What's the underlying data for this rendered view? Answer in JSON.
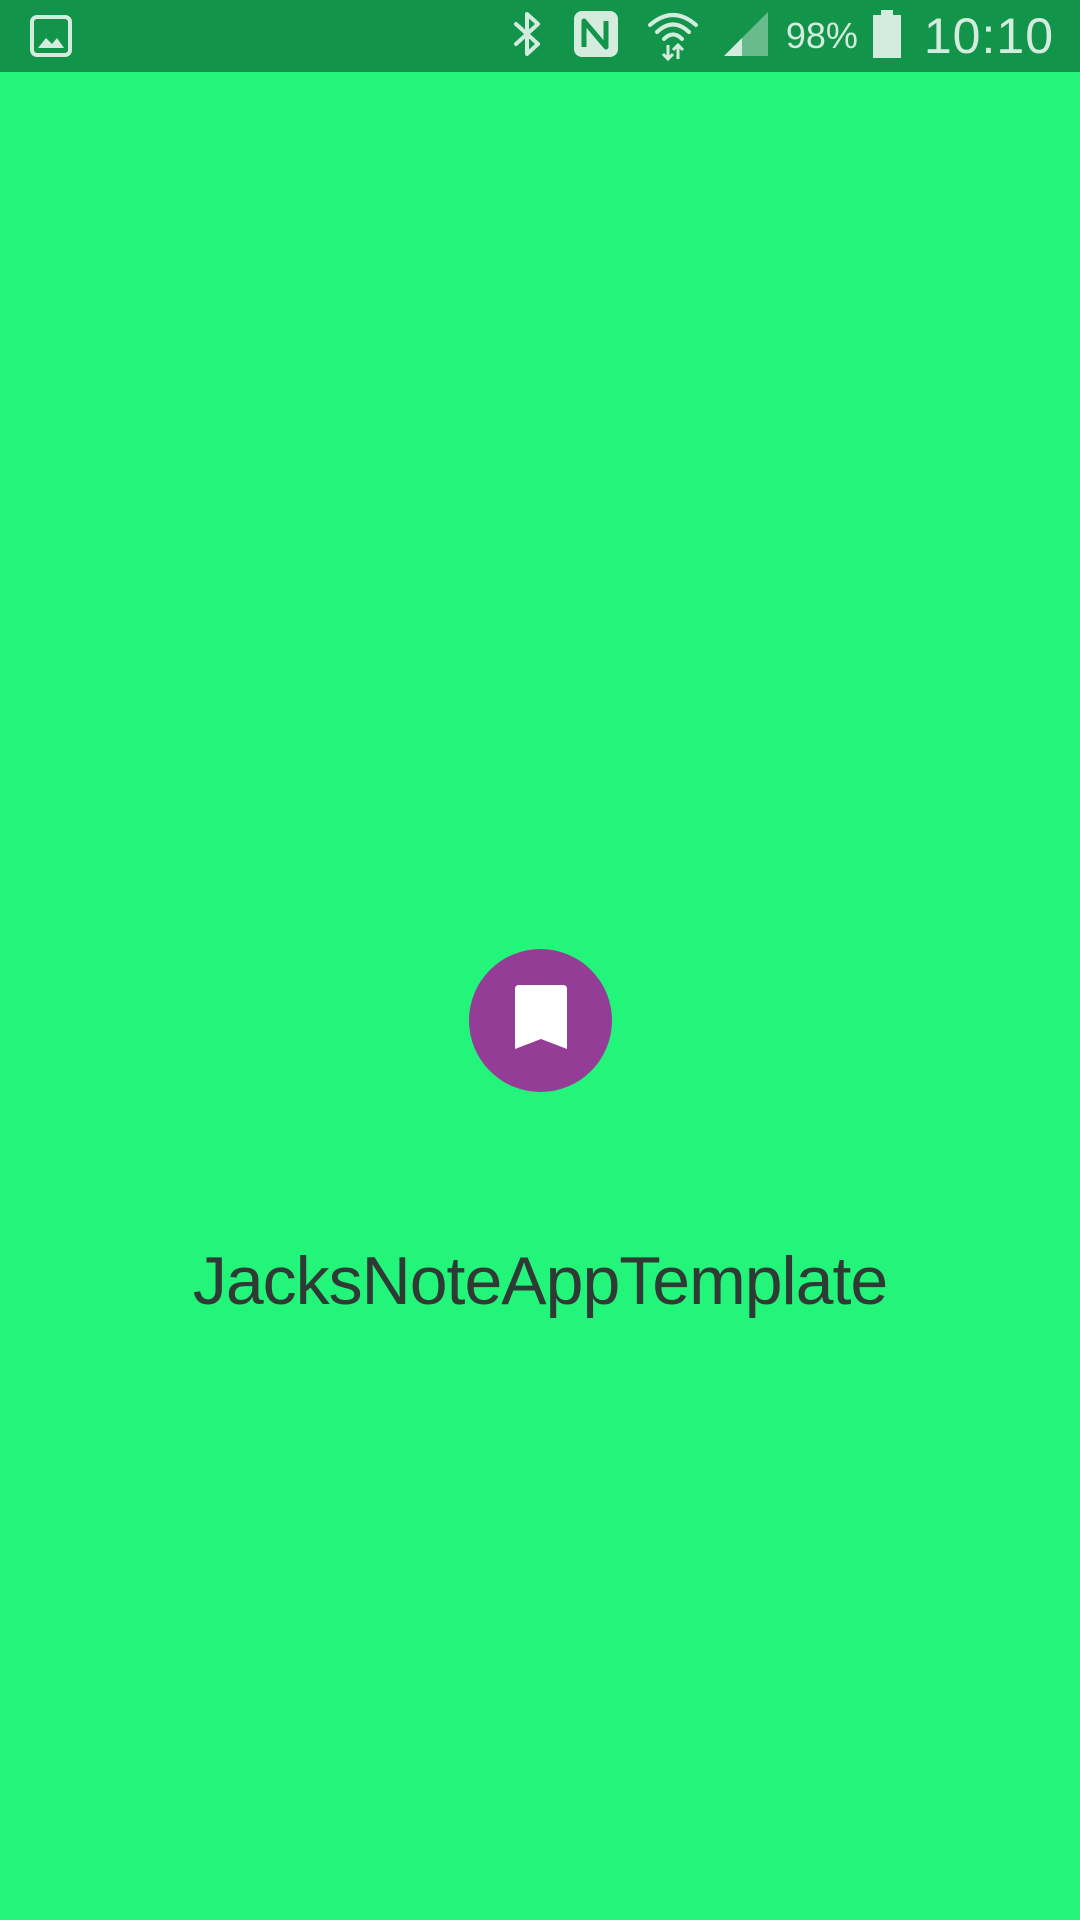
{
  "colors": {
    "status_bar_bg": "#12944b",
    "screen_bg": "#23f57b",
    "logo_circle": "#943d96",
    "logo_icon": "#ffffff",
    "title_text": "#2e3a33",
    "status_icons": "#d4ecdd"
  },
  "status_bar": {
    "notification_icon": "gallery-image-icon",
    "icons": [
      "bluetooth-icon",
      "nfc-icon",
      "wifi-icon",
      "cellular-signal-icon",
      "battery-icon"
    ],
    "battery_percent": "98%",
    "battery_level": 0.98,
    "time": "10:10"
  },
  "splash": {
    "logo_icon": "bookmark-icon",
    "app_name": "JacksNoteAppTemplate"
  }
}
